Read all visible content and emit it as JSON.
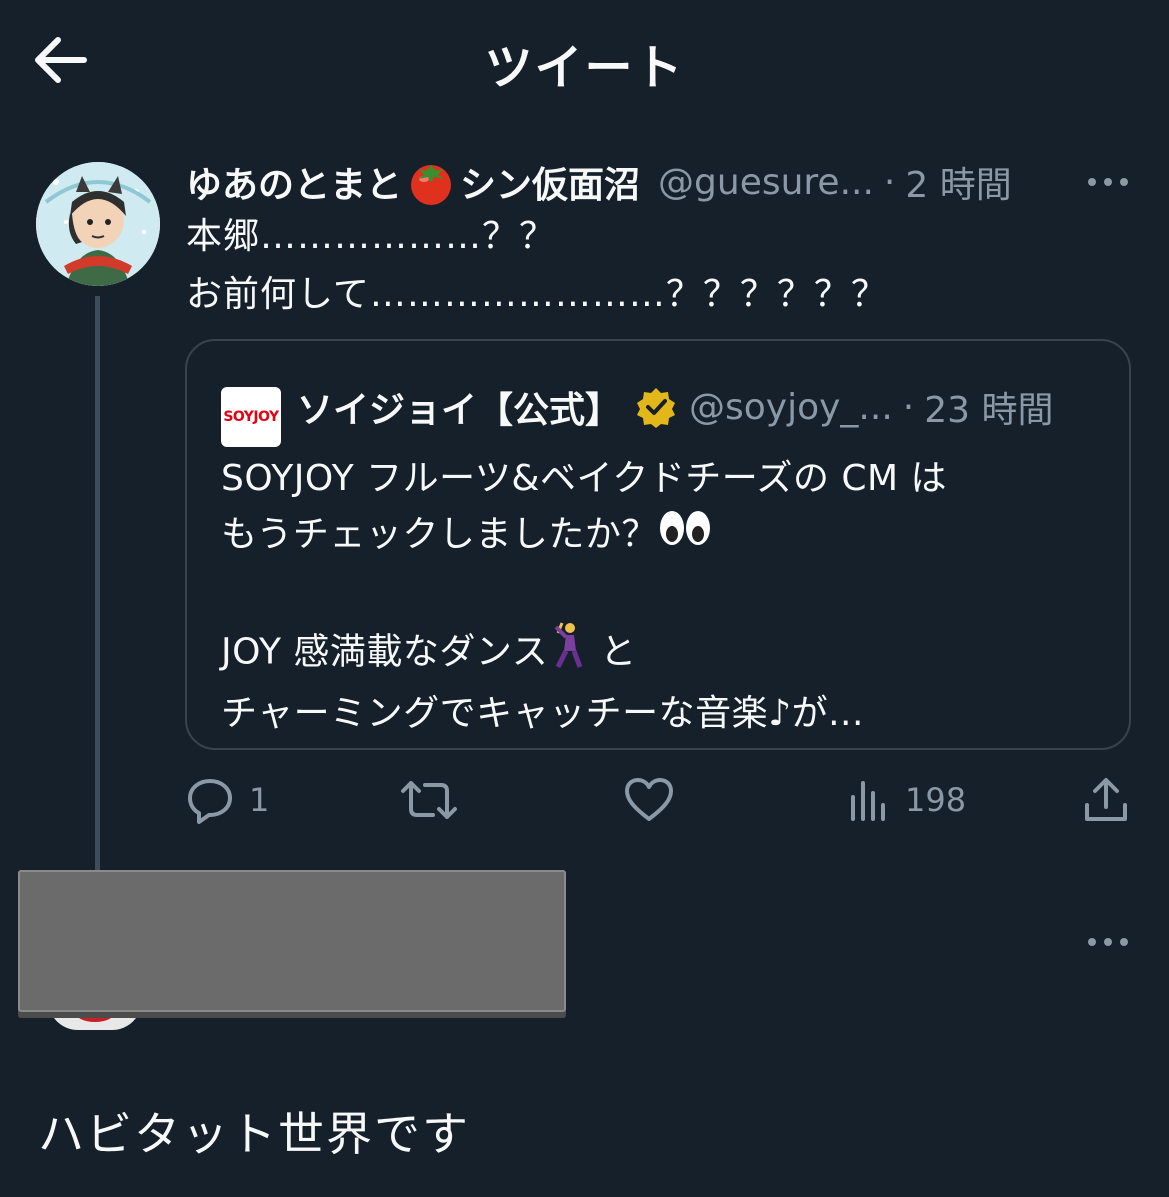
{
  "header": {
    "title": "ツイート",
    "back_icon": "arrow-left-icon"
  },
  "tweet": {
    "display_name": "ゆあのとまと",
    "display_name_suffix": "シン仮面沼",
    "emoji": "tomato-icon",
    "handle": "@guesure...",
    "separator": "·",
    "time": "2 時間",
    "text": "本郷………………？？\nお前何して……………………？？？？？？",
    "quote": {
      "logo_text": "SOYJOY",
      "display_name": "ソイジョイ【公式】",
      "verified_icon": "verified-gold-badge-icon",
      "handle": "@soyjoy_...",
      "time": "23 時間",
      "line1": "SOYJOY フルーツ&ベイクドチーズの CM は",
      "line2": "もうチェックしましたか？",
      "line3": "",
      "line4a": "JOY 感満載なダンス",
      "line4b": " と",
      "line5": "チャーミングでキャッチーな音楽♪が..."
    },
    "actions": {
      "reply_count": "1",
      "retweet_count": "",
      "like_count": "",
      "views_count": "198"
    }
  },
  "reply": {
    "text": "ハビタット世界です"
  },
  "colors": {
    "background": "#15202b",
    "text": "#f7f9f9",
    "secondary": "#8b98a5",
    "border": "#38444d",
    "verified_gold": "#e2b719"
  }
}
